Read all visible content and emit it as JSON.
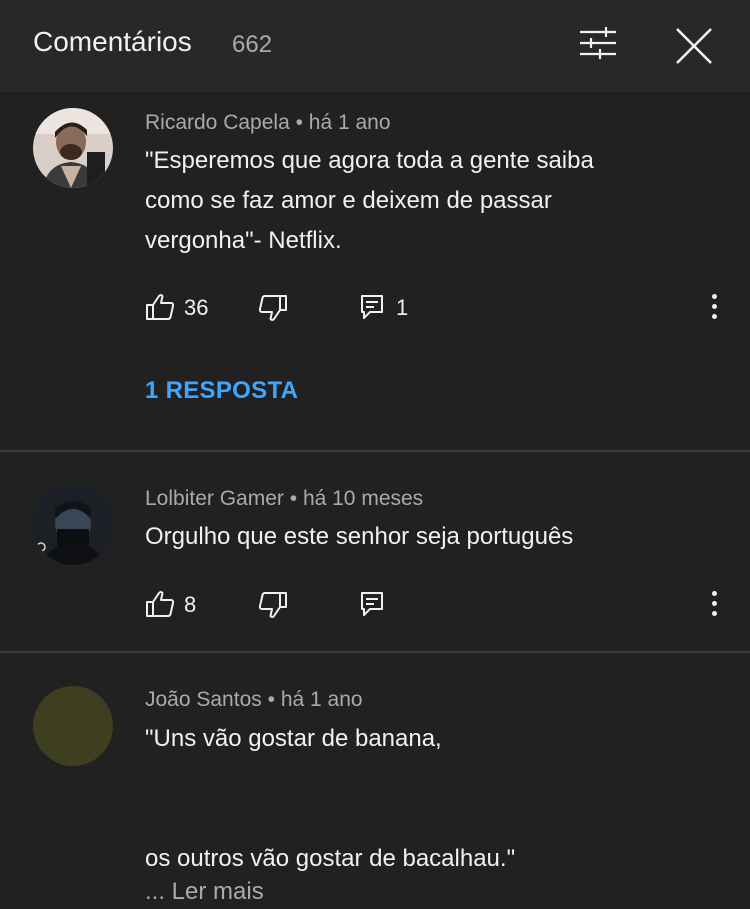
{
  "header": {
    "title": "Comentários",
    "count": "662"
  },
  "comments": [
    {
      "author": "Ricardo Capela",
      "time": "há 1 ano",
      "lines": [
        "\"Esperemos que agora toda a gente saiba",
        "como se faz amor e deixem de passar",
        "vergonha\"- Netflix."
      ],
      "likes": "36",
      "replies_count": "1",
      "replies_link": "1 RESPOSTA"
    },
    {
      "author": "Lolbiter Gamer",
      "time": "há 10 meses",
      "lines": [
        "Orgulho que este senhor seja português"
      ],
      "likes": "8"
    },
    {
      "author": "João Santos",
      "time": "há 1 ano",
      "lines": [
        "\"Uns vão gostar de banana,",
        "",
        "",
        "os outros vão gostar de bacalhau.\""
      ],
      "read_more": "... Ler mais"
    }
  ],
  "separator": "•",
  "colors": {
    "background": "#212121",
    "header": "#282828",
    "link": "#3ea6ff",
    "secondary_text": "#aaaaaa"
  }
}
